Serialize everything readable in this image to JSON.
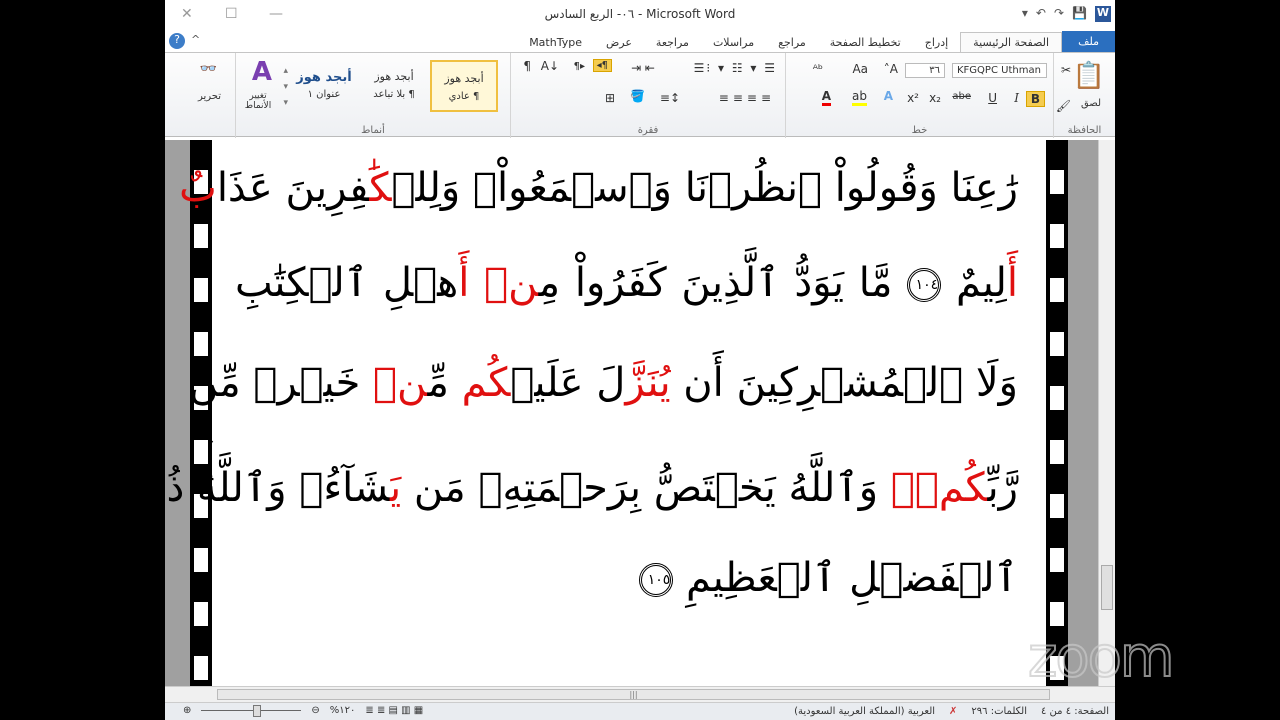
{
  "window": {
    "title": "٠٦- الربع السادس - Microsoft Word",
    "close": "✕",
    "maximize": "☐",
    "minimize": "—"
  },
  "qat": {
    "word": "W",
    "save": "💾",
    "redo": "↷",
    "undo": "↶",
    "customize": "▾"
  },
  "tabs": [
    "ملف",
    "الصفحة الرئيسية",
    "إدراج",
    "تخطيط الصفحة",
    "مراجع",
    "مراسلات",
    "مراجعة",
    "عرض",
    "MathType"
  ],
  "ribbon": {
    "clipboard": {
      "label": "الحافظة",
      "paste": "لصق"
    },
    "font": {
      "label": "خط",
      "name": "KFGQPC Uthman",
      "size": "٣٦",
      "bold": "B",
      "italic": "I",
      "underline": "U",
      "strike": "abe",
      "sub": "x₂",
      "sup": "x²",
      "grow": "A˄",
      "shrink": "A˅",
      "case": "Aa"
    },
    "paragraph": {
      "label": "فقرة",
      "pilcrow": "¶"
    },
    "styles": {
      "label": "أنماط",
      "items": [
        {
          "preview": "أبجد هوز",
          "name": "¶ عادي"
        },
        {
          "preview": "أبجد هوز",
          "name": "¶ بلا تباعد"
        },
        {
          "preview": "أبجد هوز",
          "name": "عنوان ١"
        }
      ],
      "change": "تغيير الأنماط"
    },
    "editing": {
      "label": "تحرير"
    }
  },
  "document": {
    "lines": [
      [
        {
          "t": "رَٰعِنَا وَقُولُواْ ٱنظُرۡنَا وَٱسۡمَعُواْۗ وَلِلۡ"
        },
        {
          "t": "كَٰ",
          "red": true
        },
        {
          "t": "فِرِينَ عَذَا"
        },
        {
          "t": "بٌ",
          "red": true
        }
      ],
      [
        {
          "t": "أَ",
          "red": true
        },
        {
          "t": "لِيمٌ "
        },
        {
          "ayah": "١٠٤"
        },
        {
          "t": " مَّا يَوَدُّ ٱلَّذِينَ كَفَرُواْ مِ"
        },
        {
          "t": "نۡ أَ",
          "red": true
        },
        {
          "t": "هۡلِ ٱلۡكِتَٰبِ"
        }
      ],
      [
        {
          "t": "وَلَا ٱلۡمُشۡرِكِينَ أَن "
        },
        {
          "t": "يُنَزَّ",
          "red": true
        },
        {
          "t": "لَ عَلَيۡ"
        },
        {
          "t": "كُم",
          "red": true
        },
        {
          "t": " مِّ"
        },
        {
          "t": "نۡ",
          "red": true
        },
        {
          "t": " خَيۡرٖ مِّن"
        }
      ],
      [
        {
          "t": "رَّبِّ"
        },
        {
          "t": "كُمۡۚ",
          "red": true
        },
        {
          "t": " وَٱللَّهُ يَخۡتَصُّ بِرَحۡمَتِهِۦ مَن "
        },
        {
          "t": "يَ",
          "red": true
        },
        {
          "t": "شَآءُۚ وَٱللَّهُ ذُو"
        }
      ],
      [
        {
          "t": "ٱلۡفَضۡلِ ٱلۡعَظِيمِ "
        },
        {
          "ayah": "١٠٥"
        }
      ]
    ]
  },
  "status": {
    "page": "الصفحة: ٤ من ٤",
    "words": "الكلمات: ٢٩٦",
    "language": "العربية (المملكة العربية السعودية)",
    "zoom": "%١٢٠",
    "zoom_fraction": 0.5
  },
  "overlay": {
    "zoom_logo": "zoom"
  }
}
